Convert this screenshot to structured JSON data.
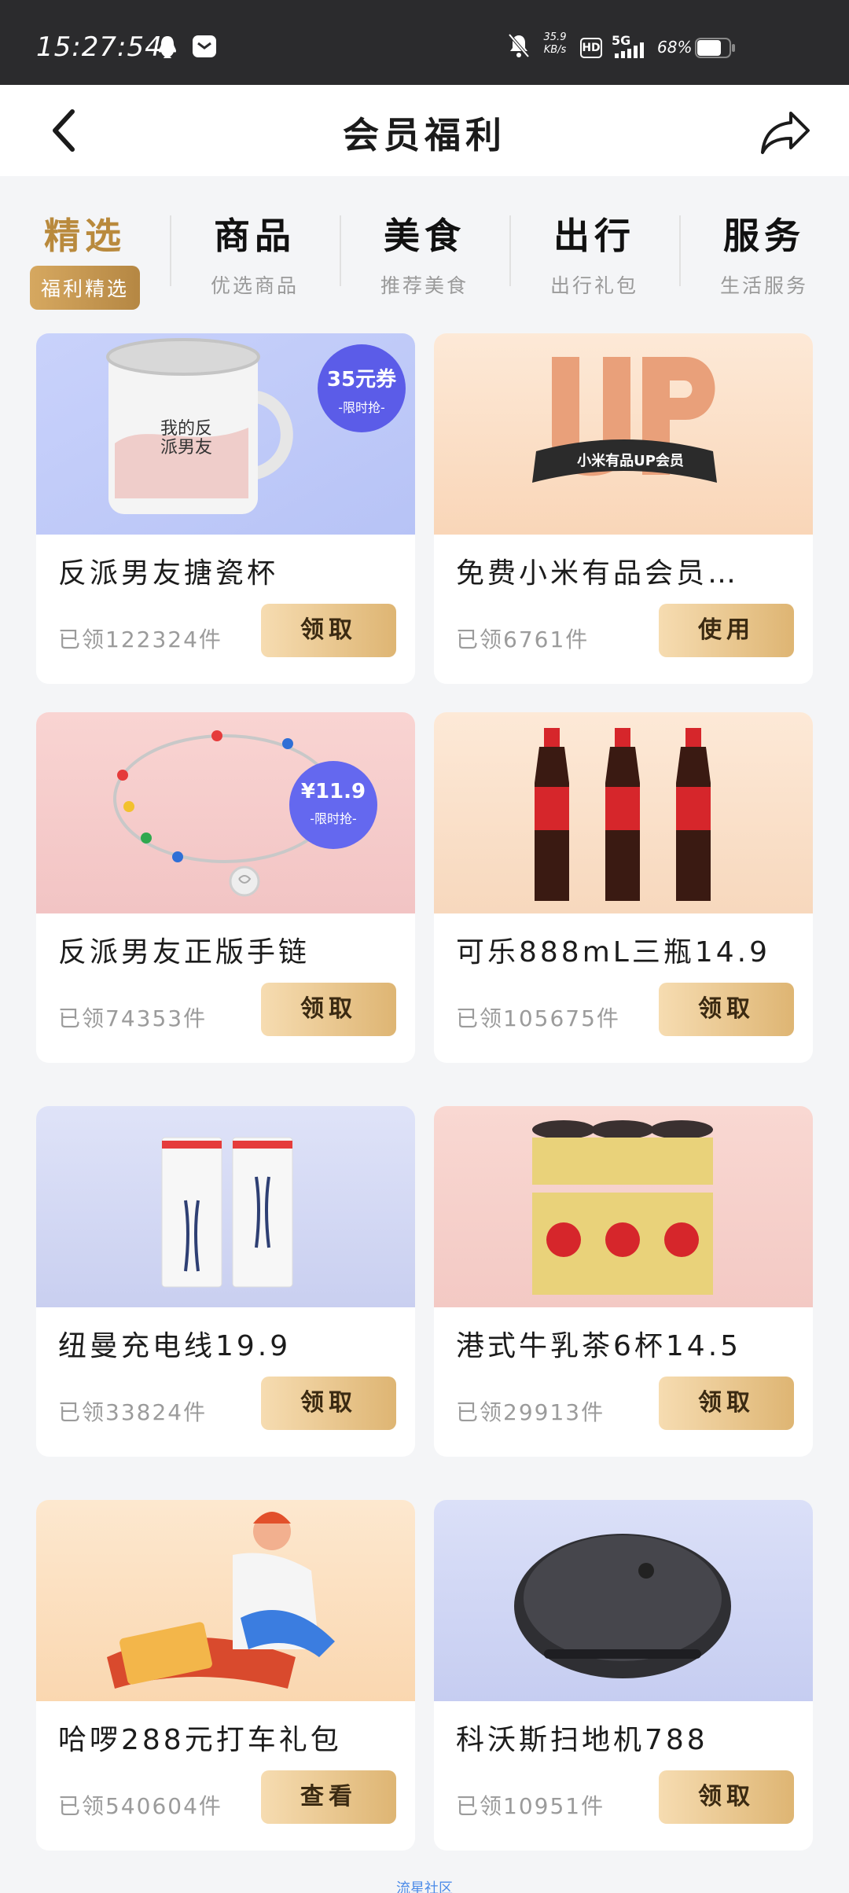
{
  "status_bar": {
    "time": "15:27:54",
    "net_speed_value": "35.9",
    "net_speed_unit": "KB/s",
    "hd": "HD",
    "network": "5G",
    "battery": "68%"
  },
  "header": {
    "title": "会员福利"
  },
  "tabs": [
    {
      "title": "精选",
      "subtitle": "福利精选",
      "active": true
    },
    {
      "title": "商品",
      "subtitle": "优选商品"
    },
    {
      "title": "美食",
      "subtitle": "推荐美食"
    },
    {
      "title": "出行",
      "subtitle": "出行礼包"
    },
    {
      "title": "服务",
      "subtitle": "生活服务"
    }
  ],
  "cards": [
    {
      "title": "反派男友搪瓷杯",
      "claimed": "已领122324件",
      "button": "领取",
      "badge_main": "35元券",
      "badge_sub": "-限时抢-",
      "mug_text": "我的反派男友"
    },
    {
      "title": "免费小米有品会员…",
      "claimed": "已领6761件",
      "button": "使用",
      "banner_text": "小米有品UP会员"
    },
    {
      "title": "反派男友正版手链",
      "claimed": "已领74353件",
      "button": "领取",
      "badge_main": "¥11.9",
      "badge_sub": "-限时抢-"
    },
    {
      "title": "可乐888mL三瓶14.9",
      "claimed": "已领105675件",
      "button": "领取"
    },
    {
      "title": "纽曼充电线19.9",
      "claimed": "已领33824件",
      "button": "领取"
    },
    {
      "title": "港式牛乳茶6杯14.5",
      "claimed": "已领29913件",
      "button": "领取"
    },
    {
      "title": "哈啰288元打车礼包",
      "claimed": "已领540604件",
      "button": "查看"
    },
    {
      "title": "科沃斯扫地机788",
      "claimed": "已领10951件",
      "button": "领取"
    }
  ],
  "footer": {
    "link": "流星社区"
  },
  "colors": {
    "accent_gold": "#b98a3d",
    "badge_purple": "#5b5ce8"
  }
}
